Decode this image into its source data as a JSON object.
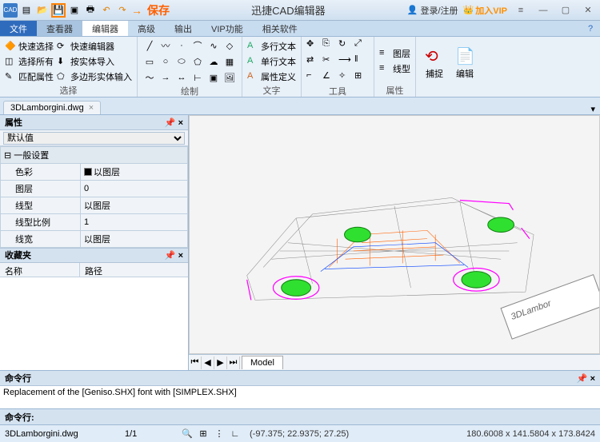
{
  "titlebar": {
    "save_annotation": "保存",
    "title": "迅捷CAD编辑器",
    "login": "登录/注册",
    "vip": "加入VIP"
  },
  "tabs": {
    "items": [
      "文件",
      "查看器",
      "编辑器",
      "高级",
      "输出",
      "VIP功能",
      "相关软件"
    ],
    "active": 0
  },
  "ribbon": {
    "group1": {
      "items": [
        "快速选择",
        "快速编辑器",
        "选择所有",
        "按实体导入",
        "匹配属性",
        "多边形实体输入"
      ],
      "label": "选择"
    },
    "group2": {
      "label": "绘制"
    },
    "group3": {
      "items": [
        "多行文本",
        "单行文本",
        "属性定义"
      ],
      "label": "文字"
    },
    "group4": {
      "label": "工具"
    },
    "group5": {
      "items": [
        "图层",
        "线型"
      ],
      "label": "属性"
    },
    "group6": {
      "capture": "捕捉",
      "edit": "编辑"
    }
  },
  "doc_tab": {
    "name": "3DLamborgini.dwg"
  },
  "props": {
    "title": "属性",
    "default": "默认值",
    "section": "一般设置",
    "rows": [
      {
        "label": "色彩",
        "value": "以图层"
      },
      {
        "label": "图层",
        "value": "0"
      },
      {
        "label": "线型",
        "value": "以图层"
      },
      {
        "label": "线型比例",
        "value": "1"
      },
      {
        "label": "线宽",
        "value": "以图层"
      }
    ]
  },
  "favorites": {
    "title": "收藏夹",
    "col1": "名称",
    "col2": "路径"
  },
  "canvas": {
    "model_tab": "Model",
    "watermark": "3DLambor"
  },
  "cmdline": {
    "title": "命令行",
    "output": "Replacement of the [Geniso.SHX] font with [SIMPLEX.SHX]",
    "prompt": "命令行:"
  },
  "status": {
    "file": "3DLamborgini.dwg",
    "page": "1/1",
    "coords": "(-97.375; 22.9375; 27.25)",
    "dims": "180.6008 x 141.5804 x 173.8424"
  }
}
